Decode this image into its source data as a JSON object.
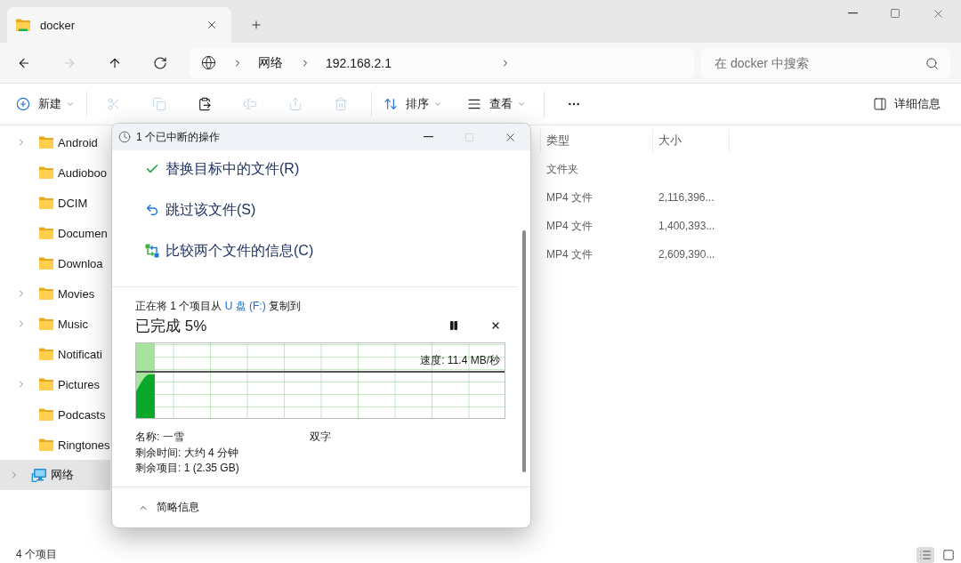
{
  "window": {
    "tab_title": "docker"
  },
  "nav_buttons": [
    {
      "kind": "back",
      "disabled": false
    },
    {
      "kind": "forward",
      "disabled": true
    },
    {
      "kind": "up",
      "disabled": false
    },
    {
      "kind": "refresh",
      "disabled": false
    }
  ],
  "address": {
    "segments": [
      "网络",
      "192.168.2.1"
    ]
  },
  "search": {
    "placeholder": "在 docker 中搜索"
  },
  "command_bar": {
    "groups": [
      {
        "items": [
          {
            "kind": "new",
            "label": "新建",
            "disabled": false
          }
        ]
      },
      {
        "items": [
          {
            "kind": "cut",
            "disabled": true
          },
          {
            "kind": "copy",
            "disabled": true
          },
          {
            "kind": "paste",
            "disabled": false
          },
          {
            "kind": "rename",
            "disabled": true
          },
          {
            "kind": "share",
            "disabled": true
          },
          {
            "kind": "delete",
            "disabled": true
          }
        ]
      },
      {
        "items": [
          {
            "kind": "sort",
            "label": "排序",
            "disabled": false
          },
          {
            "kind": "view",
            "label": "查看",
            "disabled": false
          }
        ]
      },
      {
        "items": [
          {
            "kind": "more",
            "disabled": false
          }
        ]
      }
    ],
    "details_label": "详细信息"
  },
  "sidebar": {
    "folder_items": [
      {
        "label": "Android",
        "expandable": true,
        "selected": false
      },
      {
        "label": "Audioboo",
        "expandable": false,
        "selected": false
      },
      {
        "label": "DCIM",
        "expandable": false,
        "selected": false
      },
      {
        "label": "Documen",
        "expandable": false,
        "selected": false
      },
      {
        "label": "Downloa",
        "expandable": false,
        "selected": false
      },
      {
        "label": "Movies",
        "expandable": true,
        "selected": false
      },
      {
        "label": "Music",
        "expandable": true,
        "selected": false
      },
      {
        "label": "Notificati",
        "expandable": false,
        "selected": false
      },
      {
        "label": "Pictures",
        "expandable": true,
        "selected": false
      },
      {
        "label": "Podcasts",
        "expandable": false,
        "selected": false
      },
      {
        "label": "Ringtones",
        "expandable": false,
        "selected": false
      }
    ],
    "network_item": {
      "label": "网络",
      "expandable": true,
      "selected": true
    }
  },
  "file_list": {
    "columns": [
      "类型",
      "大小"
    ],
    "rows": [
      {
        "type": "文件夹"
      },
      {
        "type": "MP4 文件",
        "size": "2,116,396..."
      },
      {
        "type": "MP4 文件",
        "size": "1,400,393..."
      },
      {
        "type": "MP4 文件",
        "size": "2,609,390..."
      }
    ]
  },
  "dialog": {
    "title": "1 个已中断的操作",
    "window_buttons": [
      {
        "kind": "minimize",
        "disabled": false
      },
      {
        "kind": "maximize",
        "disabled": true
      },
      {
        "kind": "close",
        "disabled": false
      }
    ],
    "options": [
      {
        "kind": "replace",
        "label": "替换目标中的文件(R)"
      },
      {
        "kind": "skip",
        "label": "跳过该文件(S)"
      },
      {
        "kind": "compare",
        "label": "比较两个文件的信息(C)"
      }
    ],
    "status": {
      "before": "正在将 1 个项目从 ",
      "source": "U 盘 (F:)",
      "after": " 复制到"
    },
    "percent": "已完成 5%",
    "progress": {
      "level": 0.05,
      "speed": "速度: 11.4 MB/秒"
    },
    "details": {
      "name": "名称: 一雪",
      "name_extra": "双字",
      "time_left": "剩余时间: 大约 4 分钟",
      "items_left": "剩余项目: 1 (2.35 GB)"
    },
    "collapse_label": "简略信息"
  },
  "status_bar": {
    "item_count": "4 个项目",
    "view_buttons": [
      {
        "kind": "details",
        "selected": true
      },
      {
        "kind": "tiles",
        "selected": false
      }
    ]
  }
}
